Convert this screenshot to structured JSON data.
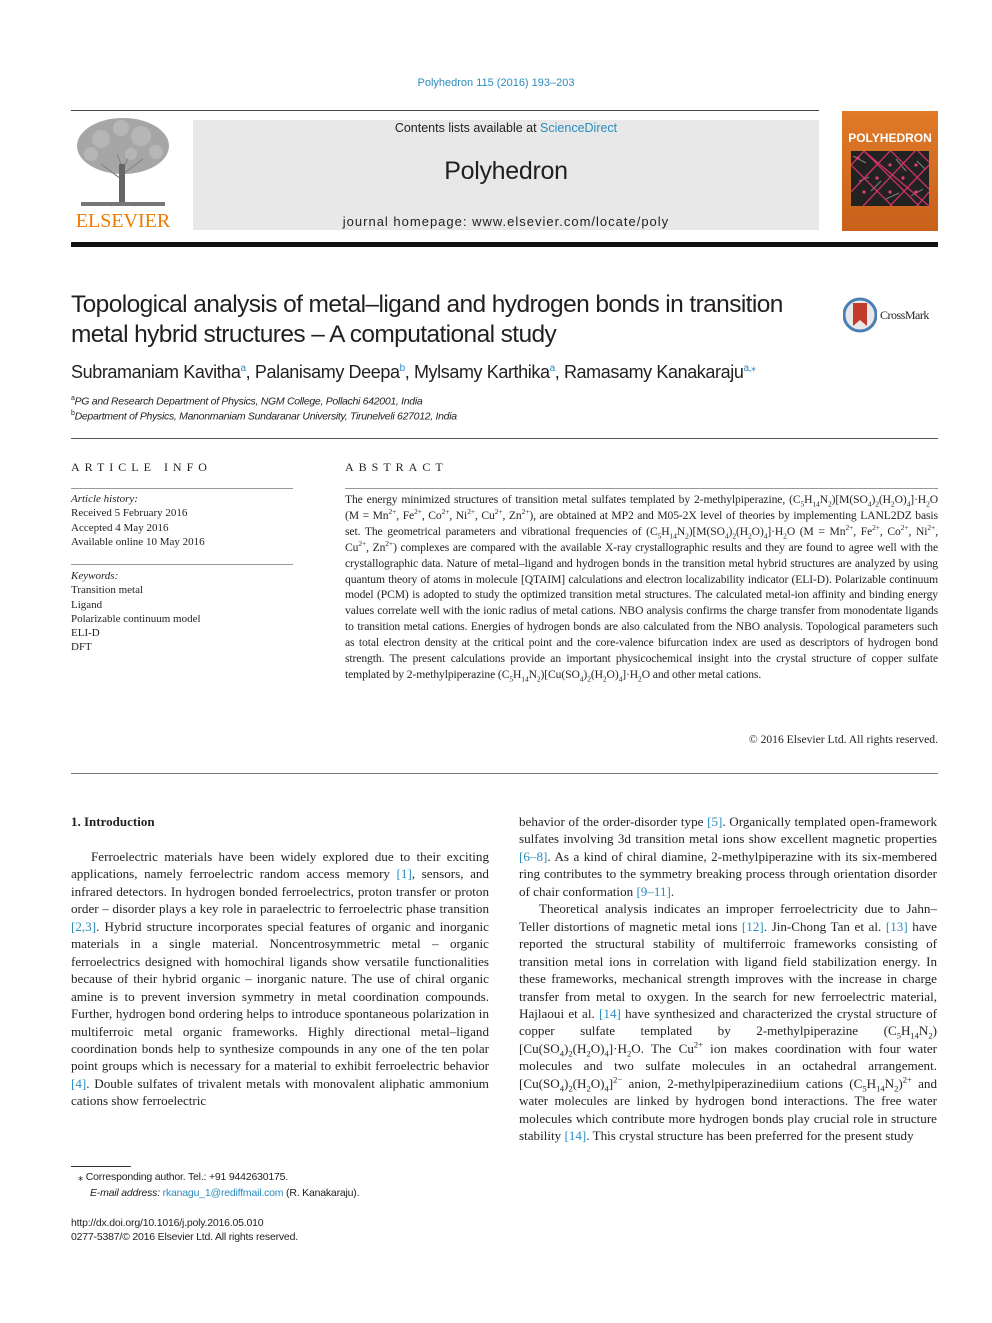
{
  "header": {
    "journal_ref": "Polyhedron 115 (2016) 193–203",
    "contents_prefix": "Contents lists available at ",
    "contents_link": "ScienceDirect",
    "journal_name": "Polyhedron",
    "homepage_prefix": "journal homepage: ",
    "homepage_url": "www.elsevier.com/locate/poly",
    "publisher_logo_text": "ELSEVIER",
    "cover_title": "POLYHEDRON",
    "colors": {
      "link": "#2a8cbf",
      "elsevier_orange": "#f07a00",
      "banner_bg": "#e8e8e8",
      "cover_orange": "#d86e22"
    }
  },
  "article": {
    "title_line1": "Topological analysis of metal–ligand and hydrogen bonds in transition",
    "title_line2": "metal hybrid structures – A computational study",
    "crossmark_label": "CrossMark",
    "authors": [
      {
        "name": "Subramaniam Kavitha",
        "sup": "a"
      },
      {
        "name": "Palanisamy Deepa",
        "sup": "b"
      },
      {
        "name": "Mylsamy Karthika",
        "sup": "a"
      },
      {
        "name": "Ramasamy Kanakaraju",
        "sup": "a,⁎"
      }
    ],
    "affiliations": [
      {
        "sup": "a",
        "text": "PG and Research Department of Physics, NGM College, Pollachi 642001, India"
      },
      {
        "sup": "b",
        "text": "Department of Physics, Manonmaniam Sundaranar University, Tirunelveli 627012, India"
      }
    ]
  },
  "article_info": {
    "heading": "ARTICLE INFO",
    "history_label": "Article history:",
    "received": "Received 5 February 2016",
    "accepted": "Accepted 4 May 2016",
    "online": "Available online 10 May 2016",
    "keywords_label": "Keywords:",
    "keywords": [
      "Transition metal",
      "Ligand",
      "Polarizable continuum model",
      "ELI-D",
      "DFT"
    ]
  },
  "abstract": {
    "heading": "ABSTRACT",
    "copyright": "© 2016 Elsevier Ltd. All rights reserved."
  },
  "introduction": {
    "heading": "1. Introduction"
  },
  "footnotes": {
    "author_note": "⁎ Corresponding author. Tel.: +91 9442630175.",
    "email_label": "E-mail address: ",
    "email": "rkanagu_1@rediffmail.com",
    "email_suffix": " (R. Kanakaraju).",
    "doi": "http://dx.doi.org/10.1016/j.poly.2016.05.010",
    "issn": "0277-5387/© 2016 Elsevier Ltd. All rights reserved."
  }
}
